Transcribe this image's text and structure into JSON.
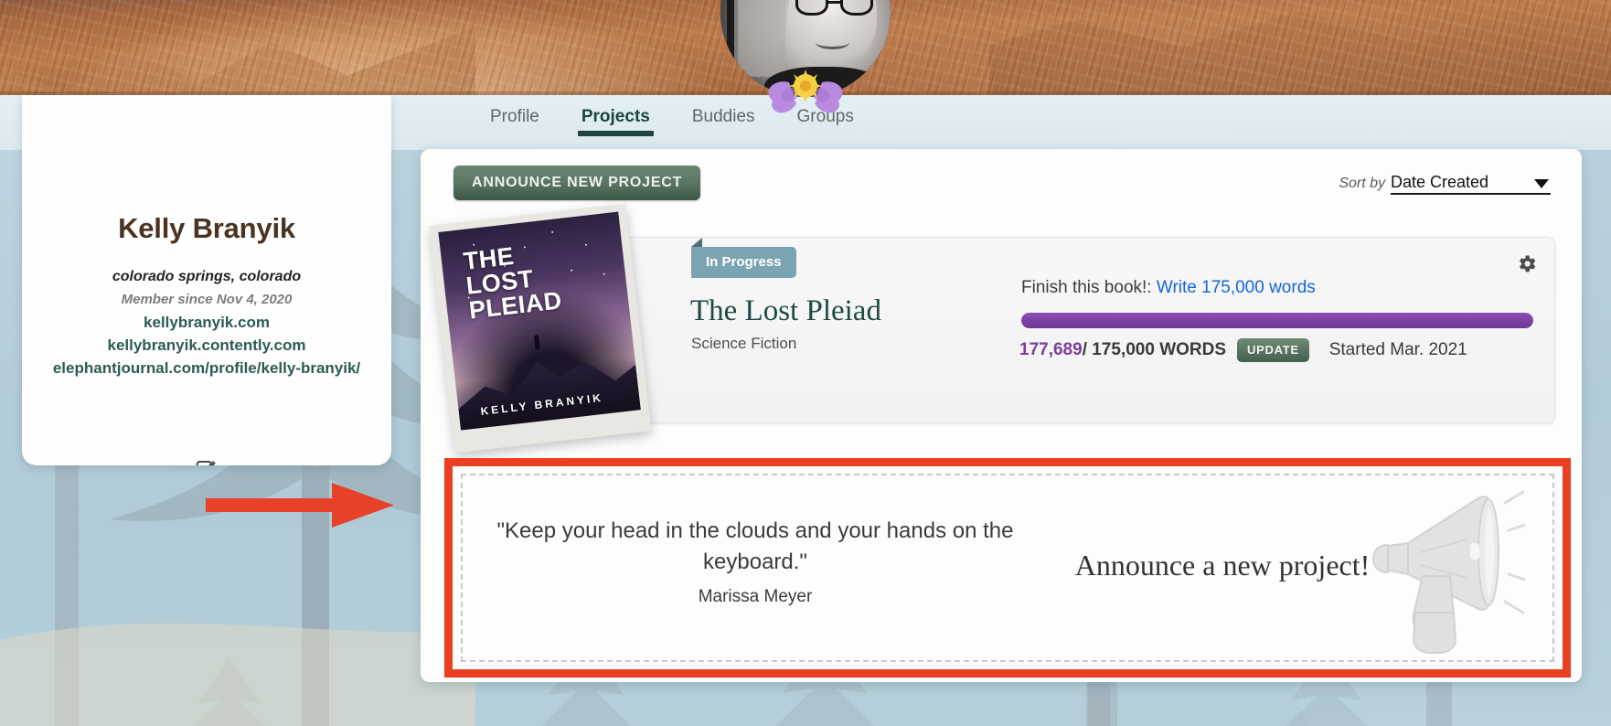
{
  "banner": {
    "name": "profile-cover-photo"
  },
  "profile": {
    "avatar_name": "user-avatar",
    "flower_name": "flower-crown-decoration",
    "name": "Kelly Branyik",
    "location": "colorado springs, colorado",
    "member_since": "Member since Nov 4, 2020",
    "links": [
      "kellybranyik.com",
      "kellybranyik.contently.com",
      "elephantjournal.com/profile/kelly-branyik/"
    ],
    "edit_icon": "edit-pencil-icon",
    "link_color": "#2c5b52",
    "name_color": "#4a3321"
  },
  "tabs": [
    {
      "label": "Profile",
      "active": false
    },
    {
      "label": "Projects",
      "active": true
    },
    {
      "label": "Buddies",
      "active": false
    },
    {
      "label": "Groups",
      "active": false
    }
  ],
  "toolbar": {
    "announce_button": "ANNOUNCE NEW PROJECT",
    "announce_button_color": "#5b7663",
    "sort_label": "Sort by",
    "sort_value": "Date Created",
    "sort_caret_icon": "chevron-down-icon"
  },
  "project": {
    "status_badge": "In Progress",
    "status_badge_color": "#7ba4b2",
    "title": "The Lost Pleiad",
    "genre": "Science Fiction",
    "cover": {
      "title_line1": "THE",
      "title_line2": "LOST",
      "title_line3": "PLEIAD",
      "author": "KELLY BRANYIK"
    },
    "goal_prefix": "Finish this book!:",
    "goal_link": "Write 175,000 words",
    "goal_link_color": "#1565d8",
    "progress_percent": 100,
    "progress_color": "#7b3fa3",
    "words_current": "177,689",
    "words_rest": " / 175,000 WORDS",
    "update_button": "UPDATE",
    "started": "Started Mar. 2021",
    "gear_icon": "gear-icon"
  },
  "announce_panel": {
    "quote": "\"Keep your head in the clouds and your hands on the keyboard.\"",
    "quote_author": "Marissa Meyer",
    "cta": "Announce a new project!",
    "megaphone_icon": "megaphone-icon",
    "highlight_color": "#ea3f21"
  },
  "annotation": {
    "arrow_icon": "red-arrow-right-annotation",
    "arrow_color": "#e8412a"
  }
}
